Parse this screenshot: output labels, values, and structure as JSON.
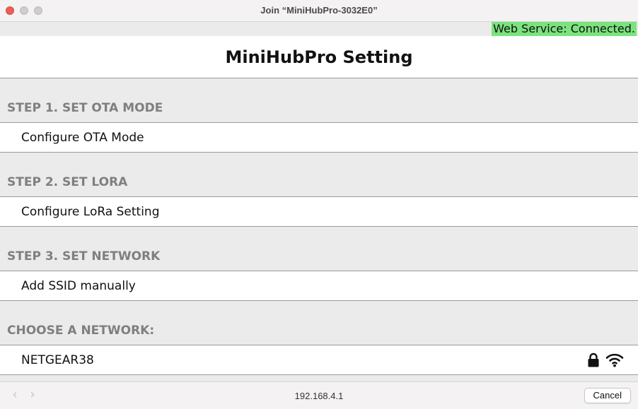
{
  "window": {
    "title": "Join “MiniHubPro-3032E0”"
  },
  "status": {
    "text": "Web Service: Connected.",
    "color": "#7ae37d"
  },
  "page": {
    "title": "MiniHubPro Setting"
  },
  "sections": [
    {
      "header": "STEP 1. SET OTA MODE",
      "item": "Configure OTA Mode"
    },
    {
      "header": "STEP 2. SET LORA",
      "item": "Configure LoRa Setting"
    },
    {
      "header": "STEP 3. SET NETWORK",
      "item": "Add SSID manually"
    }
  ],
  "networks": {
    "header": "CHOOSE A NETWORK:",
    "items": [
      {
        "ssid": "NETGEAR38",
        "icons": [
          "lock-icon",
          "wifi-icon"
        ]
      }
    ]
  },
  "toolbar": {
    "url": "192.168.4.1",
    "cancel_label": "Cancel",
    "back_icon": "chevron-left-icon",
    "forward_icon": "chevron-right-icon"
  }
}
